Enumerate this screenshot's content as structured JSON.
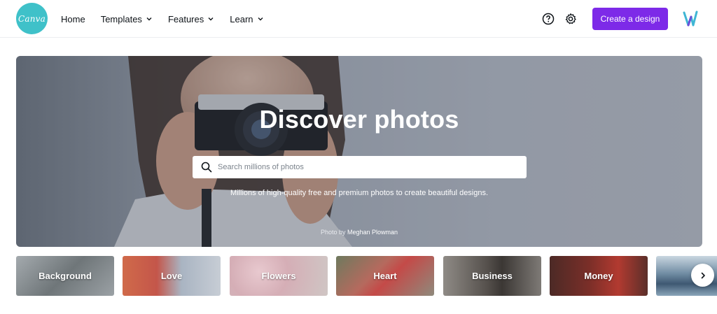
{
  "brand": {
    "logo_text": "Canva",
    "logo_color": "#3fc1c9",
    "accent": "#7d2ae8"
  },
  "nav": {
    "items": [
      {
        "label": "Home",
        "has_dropdown": false
      },
      {
        "label": "Templates",
        "has_dropdown": true
      },
      {
        "label": "Features",
        "has_dropdown": true
      },
      {
        "label": "Learn",
        "has_dropdown": true
      }
    ]
  },
  "toolbar": {
    "help_icon": "help-circle-icon",
    "settings_icon": "gear-icon",
    "create_label": "Create a design",
    "avatar_icon": "user-avatar"
  },
  "hero": {
    "title": "Discover photos",
    "search_placeholder": "Search millions of photos",
    "subtitle": "Millions of high-quality free and premium photos to create beautiful designs.",
    "credit_prefix": "Photo by",
    "credit_name": "Meghan Plowman"
  },
  "categories": [
    {
      "label": "Background",
      "color": "#8c9296"
    },
    {
      "label": "Love",
      "color": "#c7684f"
    },
    {
      "label": "Flowers",
      "color": "#d9c5c6"
    },
    {
      "label": "Heart",
      "color": "#9e7f74"
    },
    {
      "label": "Business",
      "color": "#6e6a68"
    },
    {
      "label": "Money",
      "color": "#7b3a34"
    },
    {
      "label": "",
      "color": "#7c95a8"
    }
  ],
  "carousel": {
    "next_icon": "chevron-right-icon"
  }
}
